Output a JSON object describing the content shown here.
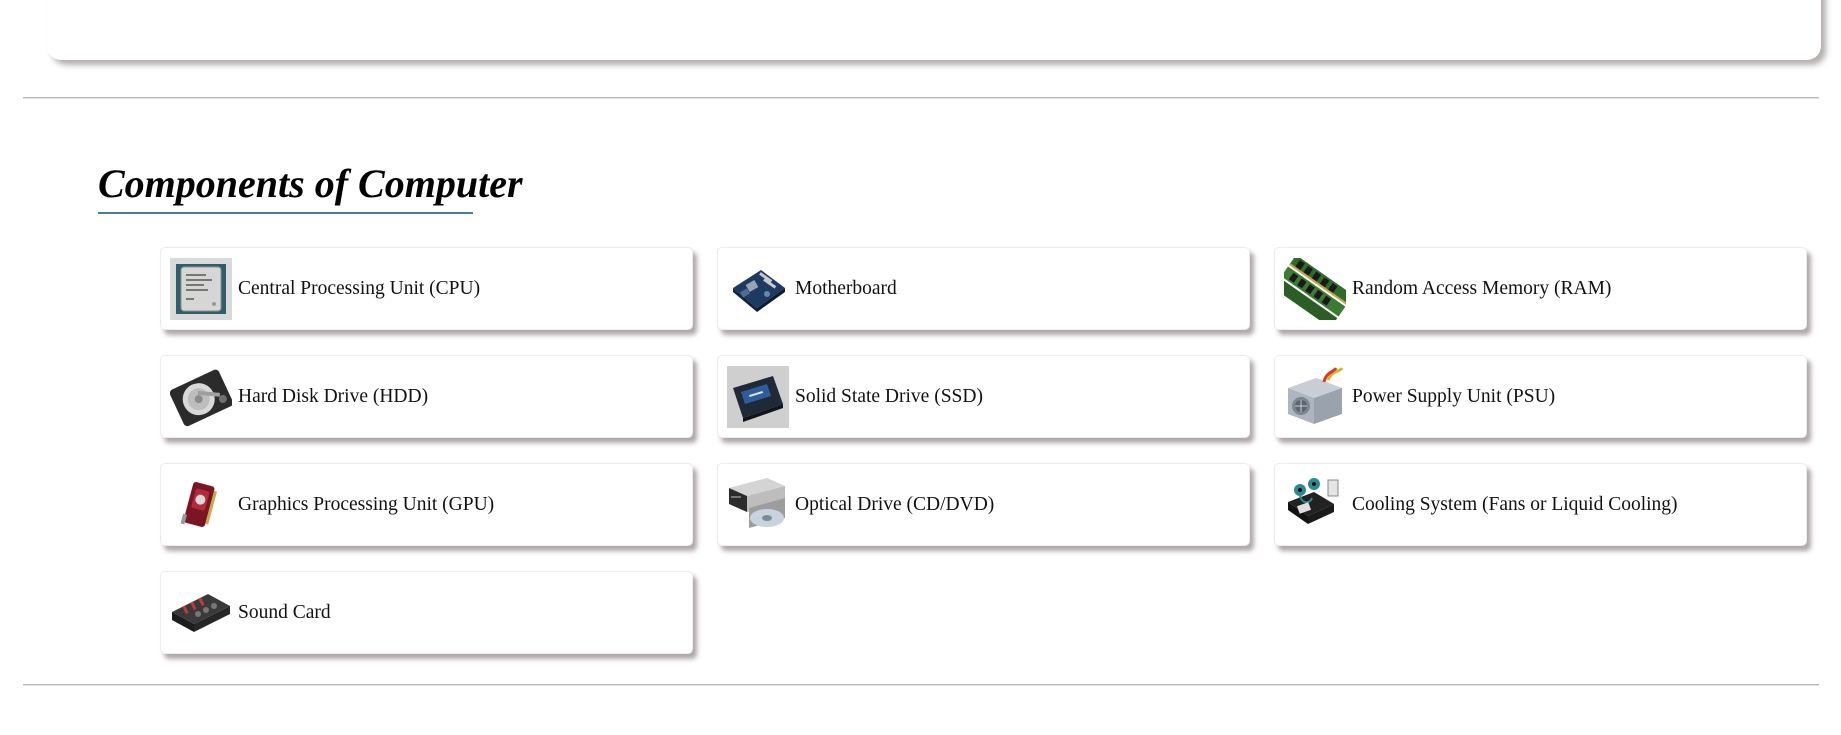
{
  "section": {
    "title": "Components of Computer"
  },
  "components": [
    {
      "label": "Central Processing Unit (CPU)",
      "icon": "cpu-chip-icon"
    },
    {
      "label": "Motherboard",
      "icon": "motherboard-icon"
    },
    {
      "label": "Random Access Memory (RAM)",
      "icon": "ram-module-icon"
    },
    {
      "label": "Hard Disk Drive (HDD)",
      "icon": "hard-disk-icon"
    },
    {
      "label": "Solid State Drive (SSD)",
      "icon": "ssd-icon"
    },
    {
      "label": "Power Supply Unit (PSU)",
      "icon": "power-supply-icon"
    },
    {
      "label": "Graphics Processing Unit (GPU)",
      "icon": "graphics-card-icon"
    },
    {
      "label": "Optical Drive (CD/DVD)",
      "icon": "optical-drive-icon"
    },
    {
      "label": "Cooling System (Fans or Liquid Cooling)",
      "icon": "cooling-system-icon"
    },
    {
      "label": "Sound Card",
      "icon": "sound-card-icon"
    }
  ],
  "colors": {
    "title_underline": "#4a7d9c",
    "card_shadow": "#8a7a80",
    "divider": "#b9b9b9"
  }
}
